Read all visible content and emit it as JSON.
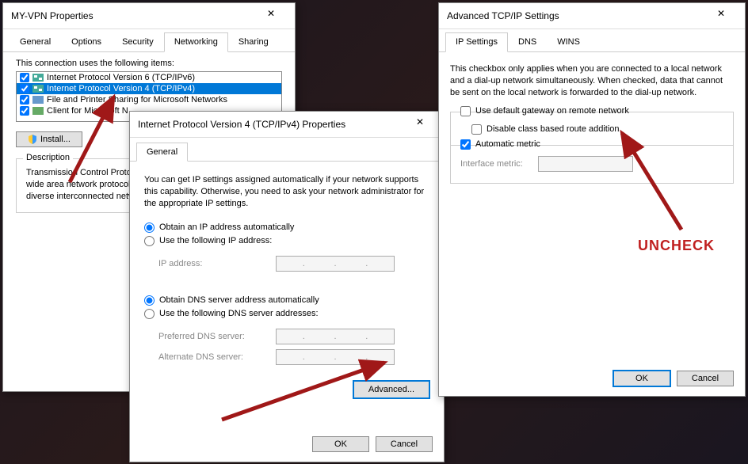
{
  "vpn": {
    "title": "MY-VPN Properties",
    "tabs": [
      "General",
      "Options",
      "Security",
      "Networking",
      "Sharing"
    ],
    "activeTab": 3,
    "listLabel": "This connection uses the following items:",
    "items": [
      {
        "label": "Internet Protocol Version 6 (TCP/IPv6)",
        "checked": true
      },
      {
        "label": "Internet Protocol Version 4 (TCP/IPv4)",
        "checked": true,
        "selected": true
      },
      {
        "label": "File and Printer Sharing for Microsoft Networks",
        "checked": true
      },
      {
        "label": "Client for Microsoft N",
        "checked": true
      }
    ],
    "install": "Install...",
    "descLegend": "Description",
    "descText": "Transmission Control Protocol/Internet Protocol. The default wide area network protocol that provides communication across diverse interconnected networks."
  },
  "ipv4": {
    "title": "Internet Protocol Version 4 (TCP/IPv4) Properties",
    "tabs": [
      "General"
    ],
    "help": "You can get IP settings assigned automatically if your network supports this capability. Otherwise, you need to ask your network administrator for the appropriate IP settings.",
    "r1": "Obtain an IP address automatically",
    "r2": "Use the following IP address:",
    "ipLabel": "IP address:",
    "r3": "Obtain DNS server address automatically",
    "r4": "Use the following DNS server addresses:",
    "dns1": "Preferred DNS server:",
    "dns2": "Alternate DNS server:",
    "advanced": "Advanced...",
    "ok": "OK",
    "cancel": "Cancel"
  },
  "adv": {
    "title": "Advanced TCP/IP Settings",
    "tabs": [
      "IP Settings",
      "DNS",
      "WINS"
    ],
    "help": "This checkbox only applies when you are connected to a local network and a dial-up network simultaneously.  When checked, data that cannot be sent on the local network is forwarded to the dial-up network.",
    "chk1": "Use default gateway on remote network",
    "chk2": "Disable class based route addition",
    "chk3": "Automatic metric",
    "metricLabel": "Interface metric:",
    "ok": "OK",
    "cancel": "Cancel"
  },
  "callout": "UNCHECK"
}
